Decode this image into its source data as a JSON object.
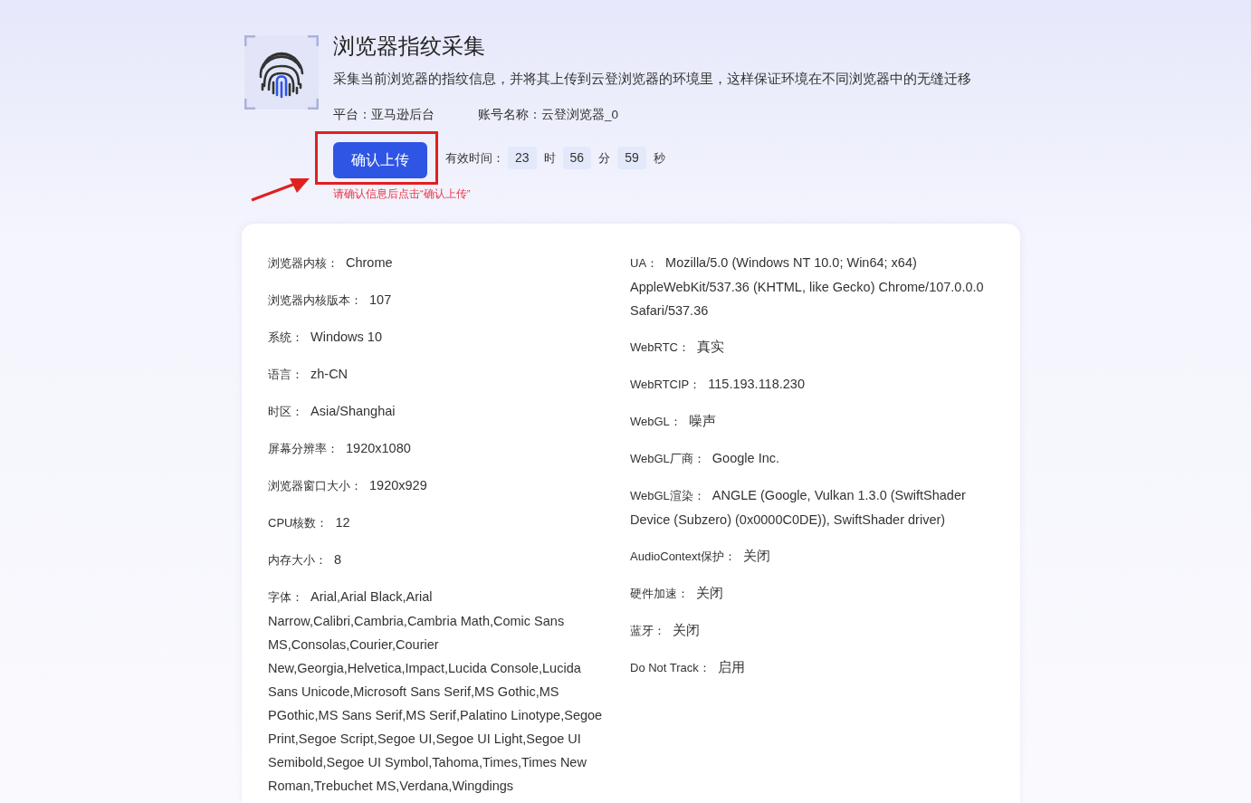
{
  "header": {
    "title": "浏览器指纹采集",
    "description": "采集当前浏览器的指纹信息，并将其上传到云登浏览器的环境里，这样保证环境在不同浏览器中的无缝迁移",
    "meta": [
      {
        "label": "平台：",
        "value": "亚马逊后台"
      },
      {
        "label": "账号名称：",
        "value": "云登浏览器_0"
      }
    ],
    "button": "确认上传",
    "validity_label": "有效时间：",
    "countdown": [
      {
        "value": "23",
        "unit": "时"
      },
      {
        "value": "56",
        "unit": "分"
      },
      {
        "value": "59",
        "unit": "秒"
      }
    ],
    "hint": "请确认信息后点击“确认上传”"
  },
  "left_fields": [
    {
      "label": "浏览器内核：",
      "value": "Chrome"
    },
    {
      "label": "浏览器内核版本：",
      "value": "107"
    },
    {
      "label": "系统：",
      "value": "Windows 10"
    },
    {
      "label": "语言：",
      "value": "zh-CN"
    },
    {
      "label": "时区：",
      "value": "Asia/Shanghai"
    },
    {
      "label": "屏幕分辨率：",
      "value": "1920x1080"
    },
    {
      "label": "浏览器窗口大小：",
      "value": "1920x929"
    },
    {
      "label": "CPU核数：",
      "value": "12"
    },
    {
      "label": "内存大小：",
      "value": "8"
    },
    {
      "label": "字体：",
      "value": "Arial,Arial Black,Arial Narrow,Calibri,Cambria,Cambria Math,Comic Sans MS,Consolas,Courier,Courier New,Georgia,Helvetica,Impact,Lucida Console,Lucida Sans Unicode,Microsoft Sans Serif,MS Gothic,MS PGothic,MS Sans Serif,MS Serif,Palatino Linotype,Segoe Print,Segoe Script,Segoe UI,Segoe UI Light,Segoe UI Semibold,Segoe UI Symbol,Tahoma,Times,Times New Roman,Trebuchet MS,Verdana,Wingdings"
    }
  ],
  "right_fields": [
    {
      "label": "UA：",
      "value": "Mozilla/5.0 (Windows NT 10.0; Win64; x64) AppleWebKit/537.36 (KHTML, like Gecko) Chrome/107.0.0.0 Safari/537.36"
    },
    {
      "label": "WebRTC：",
      "value": "真实"
    },
    {
      "label": "WebRTCIP：",
      "value": "115.193.118.230"
    },
    {
      "label": "WebGL：",
      "value": "噪声"
    },
    {
      "label": "WebGL厂商：",
      "value": "Google Inc."
    },
    {
      "label": "WebGL渲染：",
      "value": "ANGLE (Google, Vulkan 1.3.0 (SwiftShader Device (Subzero) (0x0000C0DE)), SwiftShader driver)"
    },
    {
      "label": "AudioContext保护：",
      "value": "关闭"
    },
    {
      "label": "硬件加速：",
      "value": "关闭"
    },
    {
      "label": "蓝牙：",
      "value": "关闭"
    },
    {
      "label": "Do Not Track：",
      "value": "启用"
    }
  ]
}
